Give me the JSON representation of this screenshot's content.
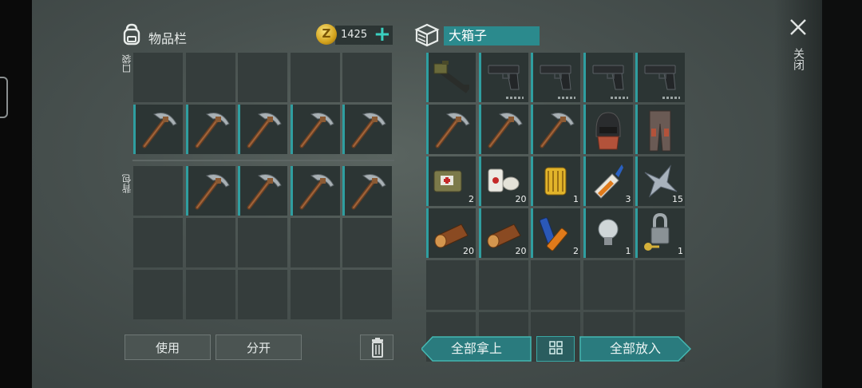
{
  "inventory": {
    "title": "物品栏",
    "coins": "1425",
    "plus_label": "+",
    "pocket_label": "口袋",
    "backpack_label": "背包",
    "pocket_slots": [
      "",
      "",
      "",
      "",
      "",
      "pickaxe",
      "pickaxe",
      "pickaxe",
      "pickaxe",
      "pickaxe"
    ],
    "backpack_slots": [
      "",
      "pickaxe",
      "pickaxe",
      "pickaxe",
      "pickaxe",
      "",
      "",
      "",
      "",
      "",
      "",
      "",
      "",
      "",
      ""
    ]
  },
  "chest": {
    "title": "大箱子",
    "slots": [
      {
        "item": "assault-rifle"
      },
      {
        "item": "pistol"
      },
      {
        "item": "pistol"
      },
      {
        "item": "pistol"
      },
      {
        "item": "pistol"
      },
      {
        "item": "pickaxe"
      },
      {
        "item": "pickaxe"
      },
      {
        "item": "pickaxe"
      },
      {
        "item": "helmet"
      },
      {
        "item": "leg-armor"
      },
      {
        "item": "first-aid-bag",
        "qty": "2"
      },
      {
        "item": "bandage",
        "qty": "20"
      },
      {
        "item": "oil-filter",
        "qty": "1"
      },
      {
        "item": "glue",
        "qty": "3"
      },
      {
        "item": "scrap-metal",
        "qty": "15"
      },
      {
        "item": "log",
        "qty": "20"
      },
      {
        "item": "log",
        "qty": "20"
      },
      {
        "item": "batteries",
        "qty": "2"
      },
      {
        "item": "light-bulb",
        "qty": "1"
      },
      {
        "item": "padlock-key",
        "qty": "1"
      },
      {
        "item": ""
      },
      {
        "item": ""
      },
      {
        "item": ""
      },
      {
        "item": ""
      },
      {
        "item": ""
      },
      {
        "item": ""
      },
      {
        "item": ""
      },
      {
        "item": ""
      },
      {
        "item": ""
      },
      {
        "item": ""
      }
    ]
  },
  "actions": {
    "use": "使用",
    "split": "分开",
    "take_all": "全部拿上",
    "put_all": "全部放入"
  },
  "close_label": "关闭",
  "colors": {
    "accent": "#2f9ea0",
    "coin": "#d2a21c"
  },
  "icons": [
    "backpack-icon",
    "coin-icon",
    "chest-icon",
    "trash-icon",
    "grid-icon",
    "close-icon"
  ]
}
